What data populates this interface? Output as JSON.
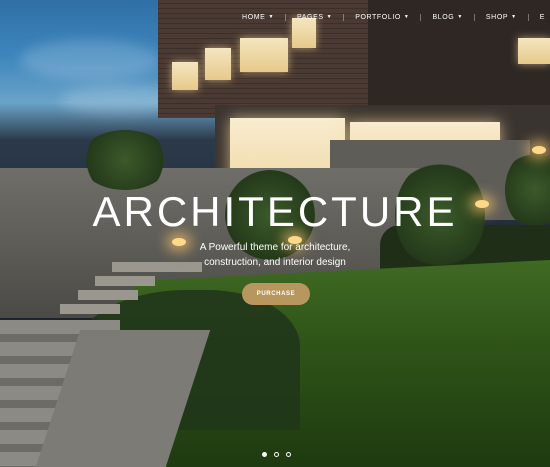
{
  "nav": {
    "items": [
      {
        "label": "HOME",
        "caret": "▼"
      },
      {
        "label": "PAGES",
        "caret": "▼"
      },
      {
        "label": "PORTFOLIO",
        "caret": "▼"
      },
      {
        "label": "BLOG",
        "caret": "▼"
      },
      {
        "label": "SHOP",
        "caret": "▼"
      },
      {
        "label": "E",
        "caret": ""
      }
    ]
  },
  "hero": {
    "title": "ARCHITECTURE",
    "subtitle_line1": "A Powerful theme for architecture,",
    "subtitle_line2": "construction, and interior design",
    "cta_label": "PURCHASE"
  },
  "slider": {
    "active_index": 0,
    "count": 3
  },
  "colors": {
    "accent": "#b8975e",
    "text": "#ffffff"
  }
}
